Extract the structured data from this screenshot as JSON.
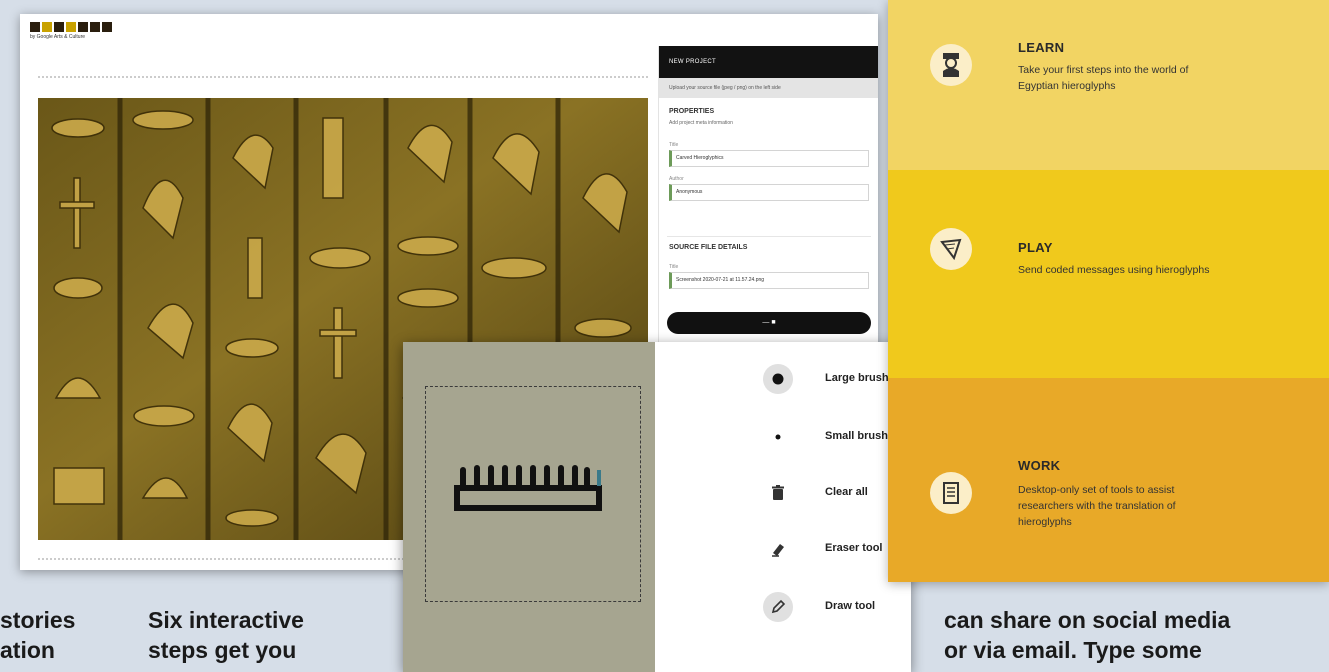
{
  "editor": {
    "logo_sub": "by Google Arts & Culture",
    "side": {
      "header": "NEW PROJECT",
      "upload_hint": "Upload your source file (jpeg / png) on the left side",
      "properties_title": "PROPERTIES",
      "properties_sub": "Add project meta information",
      "title_label": "Title",
      "title_value": "Carved Hieroglyphics",
      "author_label": "Author",
      "author_value": "Anonymous",
      "source_title": "SOURCE FILE DETAILS",
      "file_label": "Title",
      "file_value": "Screenshot 2020-07-21 at 11.57.24.png"
    }
  },
  "tools": {
    "items": [
      {
        "label": "Large brush",
        "icon": "large-brush-icon"
      },
      {
        "label": "Small brush",
        "icon": "small-brush-icon"
      },
      {
        "label": "Clear all",
        "icon": "trash-icon"
      },
      {
        "label": "Eraser tool",
        "icon": "eraser-icon"
      },
      {
        "label": "Draw tool",
        "icon": "pen-icon"
      }
    ]
  },
  "cards": {
    "learn": {
      "title": "LEARN",
      "desc1": "Take your first steps into the world of",
      "desc2": "Egyptian hieroglyphs",
      "icon": "scholar-icon"
    },
    "play": {
      "title": "PLAY",
      "desc1": "Send coded messages using hieroglyphs",
      "icon": "papyrus-icon"
    },
    "work": {
      "title": "WORK",
      "desc1": "Desktop-only set of tools to assist",
      "desc2": "researchers with the translation of",
      "desc3": "hieroglyphs",
      "icon": "document-icon"
    },
    "colors": {
      "learn": "#f2d463",
      "play": "#f0c91c",
      "work": "#e8a928"
    }
  },
  "article": {
    "col1_line1": "stories",
    "col1_line2": "ation",
    "col2_line1": "Six interactive",
    "col2_line2": "steps get you",
    "col3_line1": "can share on social media",
    "col3_line2": "or via email. Type some"
  }
}
